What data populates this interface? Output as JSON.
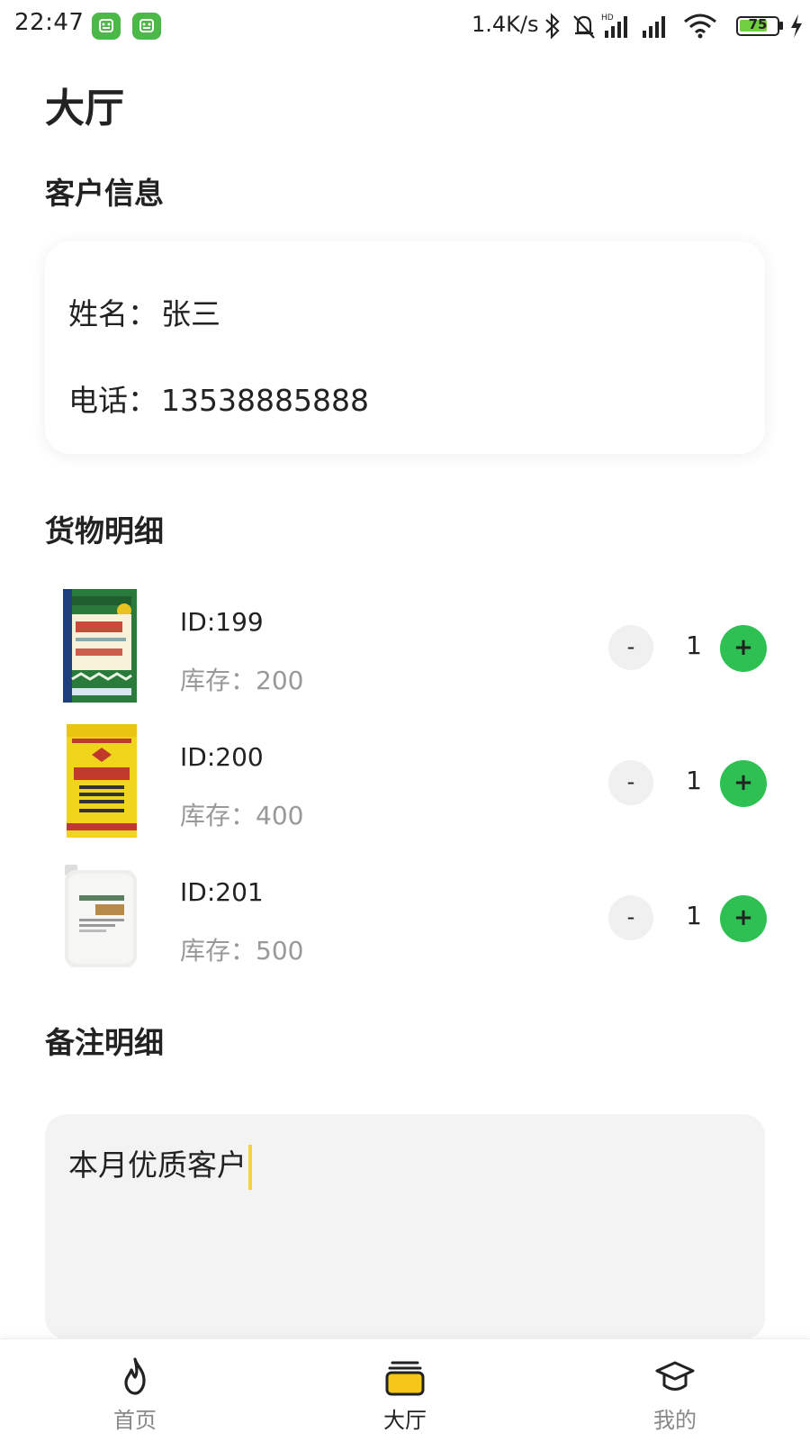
{
  "status_bar": {
    "time": "22:47",
    "net_speed": "1.4K/s",
    "battery": "75",
    "app_icon_color": "#4cb848"
  },
  "page": {
    "title": "大厅"
  },
  "customer": {
    "section_title": "客户信息",
    "name_label": "姓名：",
    "name_value": "张三",
    "phone_label": "电话：",
    "phone_value": "13538885888"
  },
  "goods": {
    "section_title": "货物明细",
    "stock_label": "库存：",
    "minus_label": "-",
    "plus_label": "+",
    "items": [
      {
        "id": "ID:199",
        "stock": "200",
        "qty": "1",
        "image": "compound-fertilizer-bag-icon"
      },
      {
        "id": "ID:200",
        "stock": "400",
        "qty": "1",
        "image": "diammonium-phosphate-bag-icon"
      },
      {
        "id": "ID:201",
        "stock": "500",
        "qty": "1",
        "image": "liquid-jerrycan-icon"
      }
    ]
  },
  "remarks": {
    "section_title": "备注明细",
    "value": "本月优质客户"
  },
  "tabbar": {
    "tabs": [
      {
        "label": "首页",
        "icon": "flame-icon",
        "active": false
      },
      {
        "label": "大厅",
        "icon": "hall-icon",
        "active": true
      },
      {
        "label": "我的",
        "icon": "graduation-cap-icon",
        "active": false
      }
    ]
  },
  "colors": {
    "accent_green": "#2fc053",
    "accent_yellow": "#f5d33b",
    "minus_bg": "#f0f0f0",
    "remarks_bg": "#f3f3f3"
  }
}
